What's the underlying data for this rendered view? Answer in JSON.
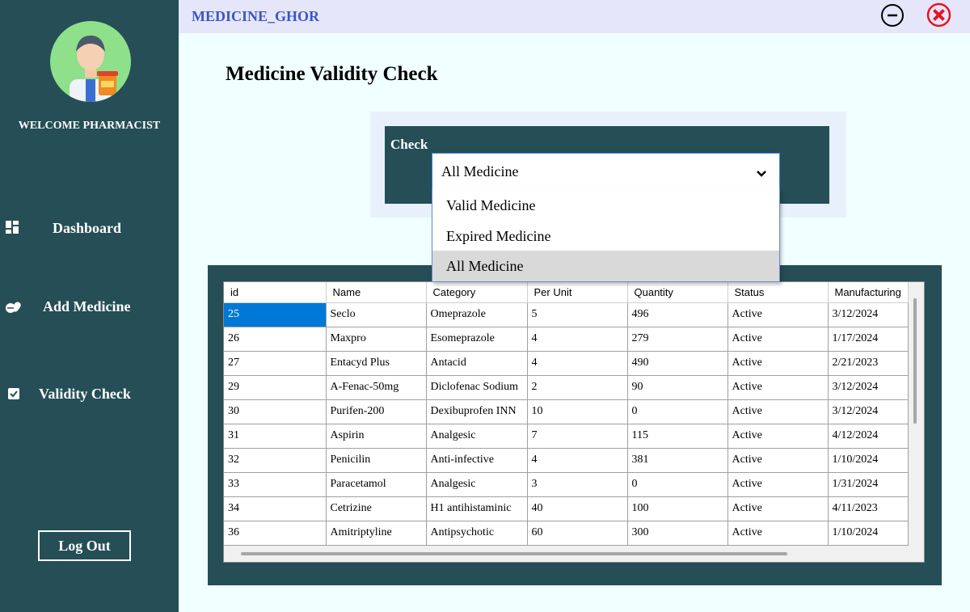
{
  "app": {
    "title": "MEDICINE_GHOR"
  },
  "sidebar": {
    "welcome": "WELCOME PHARMACIST",
    "items": [
      {
        "label": "Dashboard",
        "icon": "dashboard-icon"
      },
      {
        "label": "Add Medicine",
        "icon": "pills-icon"
      },
      {
        "label": "Validity Check",
        "icon": "checkbox-icon"
      }
    ],
    "logout": "Log Out"
  },
  "page": {
    "title": "Medicine Validity Check"
  },
  "check": {
    "label": "Check",
    "selected": "All Medicine",
    "options": [
      "Valid Medicine",
      "Expired Medicine",
      "All Medicine"
    ]
  },
  "table": {
    "columns": [
      "id",
      "Name",
      "Category",
      "Per Unit",
      "Quantity",
      "Status",
      "Manufacturing"
    ],
    "rows": [
      [
        "25",
        "Seclo",
        "Omeprazole",
        "5",
        "496",
        "Active",
        "3/12/2024"
      ],
      [
        "26",
        "Maxpro",
        "Esomeprazole",
        "4",
        "279",
        "Active",
        "1/17/2024"
      ],
      [
        "27",
        "Entacyd Plus",
        "Antacid",
        "4",
        "490",
        "Active",
        "2/21/2023"
      ],
      [
        "29",
        "A-Fenac-50mg",
        "Diclofenac Sodium",
        "2",
        "90",
        "Active",
        "3/12/2024"
      ],
      [
        "30",
        "Purifen-200",
        "Dexibuprofen INN",
        "10",
        "0",
        "Active",
        "3/12/2024"
      ],
      [
        "31",
        "Aspirin",
        "Analgesic",
        "7",
        "115",
        "Active",
        "4/12/2024"
      ],
      [
        "32",
        "Penicilin",
        "Anti-infective",
        "4",
        "381",
        "Active",
        "1/10/2024"
      ],
      [
        "33",
        "Paracetamol",
        "Analgesic",
        "3",
        "0",
        "Active",
        "1/31/2024"
      ],
      [
        "34",
        "Cetrizine",
        "H1 antihistaminic",
        "40",
        "100",
        "Active",
        "4/11/2023"
      ],
      [
        "36",
        "Amitriptyline",
        "Antipsychotic",
        "60",
        "300",
        "Active",
        "1/10/2024"
      ]
    ]
  },
  "colors": {
    "sidebar": "#254e56",
    "accent": "#3a55c6",
    "selection": "#0078d7",
    "close": "#e81123"
  }
}
